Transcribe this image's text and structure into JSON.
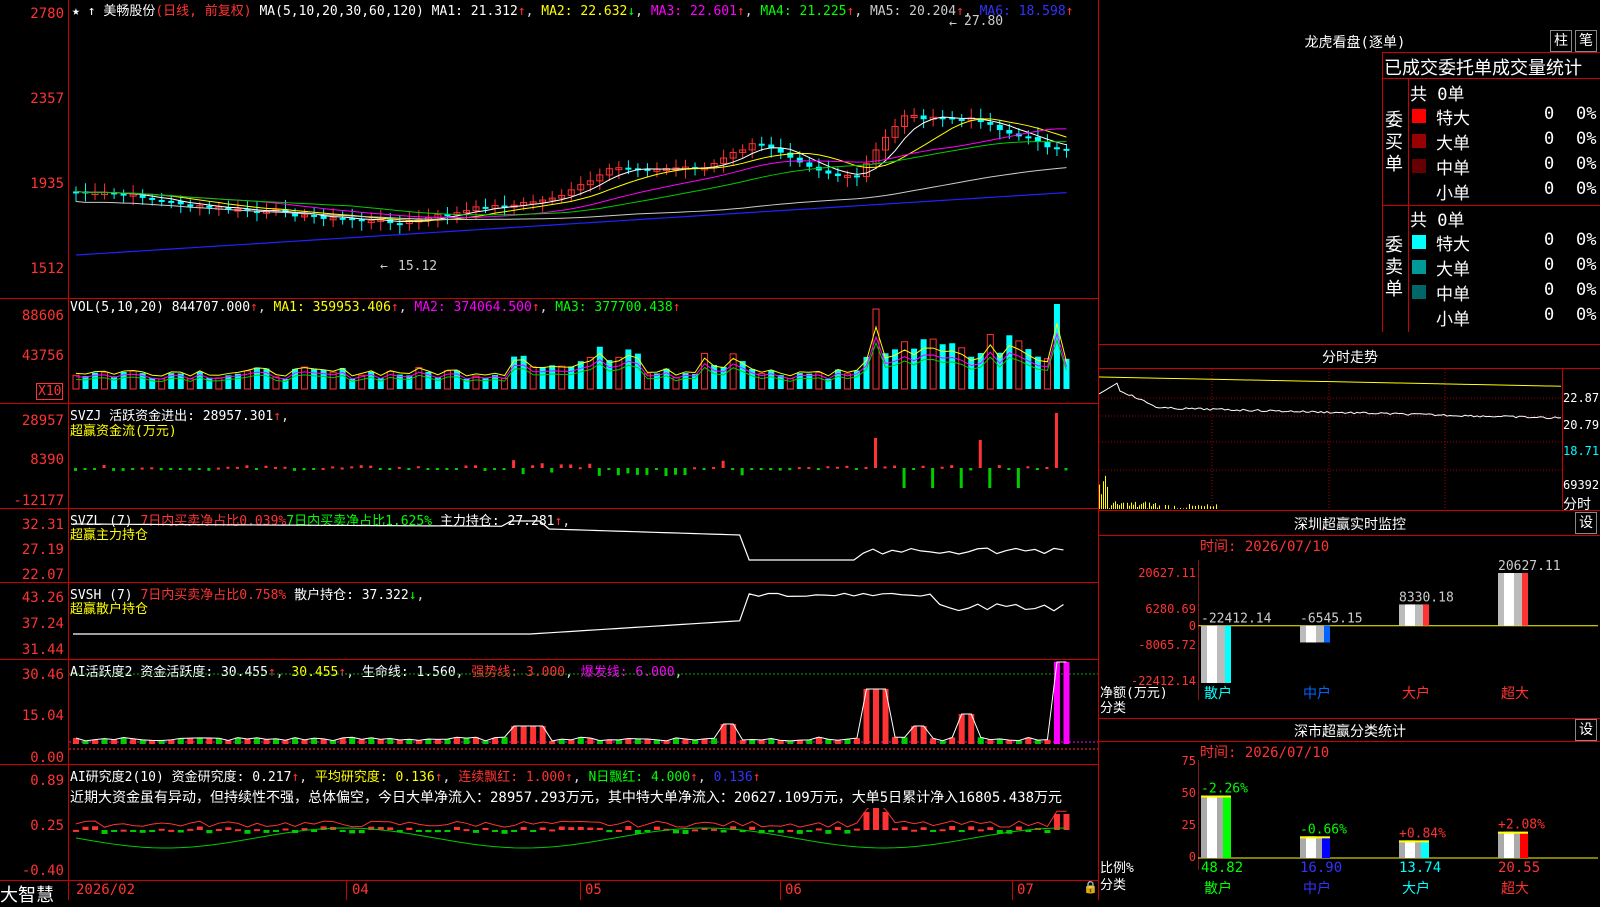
{
  "app": {
    "brand": "大智慧",
    "stock_name": "美畅股份",
    "mode": "(日线, 前复权)"
  },
  "price_panel": {
    "ticks": [
      "2780",
      "2357",
      "1935",
      "1512"
    ],
    "ma_label": "MA(5,10,20,30,60,120)",
    "ma": [
      {
        "label": "MA1: 21.312",
        "arrow": "↑",
        "color": "#ffffff"
      },
      {
        "label": "MA2: 22.632",
        "arrow": "↓",
        "color": "#ffff00"
      },
      {
        "label": "MA3: 22.601",
        "arrow": "↑",
        "color": "#ff00ff"
      },
      {
        "label": "MA4: 21.225",
        "arrow": "↑",
        "color": "#00ff00"
      },
      {
        "label": "MA5: 20.204",
        "arrow": "↑",
        "color": "#cccccc"
      },
      {
        "label": "MA6: 18.598",
        "arrow": "↑",
        "color": "#3333ff"
      }
    ],
    "high_label": "27.80",
    "low_label": "15.12"
  },
  "vol_panel": {
    "title": "VOL(5,10,20)",
    "value": "844707.000",
    "ma1": "MA1: 359953.406",
    "ma2": "MA2: 374064.500",
    "ma3": "MA3: 377700.438",
    "ticks": [
      "88606",
      "43756"
    ],
    "unit": "X10"
  },
  "svzj_panel": {
    "title": "SVZJ",
    "line1": "活跃资金进出: 28957.301",
    "sub": "超赢资金流(万元)",
    "ticks": [
      "28957",
      "8390",
      "-12177"
    ]
  },
  "svzl_panel": {
    "title": "SVZL (7)",
    "red_text": "7日内买卖净占比0.039%",
    "green_text": "7日内买卖净占比1.625%",
    "main": "主力持仓: 27.281",
    "sub": "超赢主力持仓",
    "ticks": [
      "32.31",
      "27.19",
      "22.07"
    ]
  },
  "svsh_panel": {
    "title": "SVSH (7)",
    "red_text": "7日内买卖净占比0.758%",
    "main": "散户持仓: 37.322",
    "sub": "超赢散户持仓",
    "ticks": [
      "43.26",
      "37.24",
      "31.44"
    ]
  },
  "ai_active": {
    "title": "AI活跃度2",
    "t1": "资金活跃度: 30.455",
    "t2": "30.455",
    "t3": "生命线: 1.560",
    "t4": "强势线: 3.000",
    "t5": "爆发线: 6.000",
    "ticks": [
      "30.46",
      "15.04",
      "0.00"
    ]
  },
  "ai_research": {
    "title": "AI研究度2(10)",
    "t1": "资金研究度: 0.217",
    "t2": "平均研究度: 0.136",
    "t3": "连续飘红: 1.000",
    "t4": "N日飘红: 4.000",
    "t5": "0.136",
    "comment": "近期大资金虽有异动，但持续性不强，总体偏空，今日大单净流入：28957.293万元，其中特大单净流入：20627.109万元，大单5日累计净入16805.438万元",
    "ticks": [
      "0.89",
      "0.25",
      "-0.40"
    ]
  },
  "x_axis": {
    "labels": [
      "2026/02",
      "04",
      "05",
      "06",
      "07"
    ]
  },
  "dragon_tiger": {
    "title": "龙虎看盘(逐单)",
    "btn1": "柱",
    "btn2": "笔",
    "header": "已成交委托单成交量统计",
    "buy_label": "委买单",
    "sell_label": "委卖单",
    "buy_total": "共 0单",
    "sell_total": "共 0单",
    "buy_rows": [
      {
        "name": "特大",
        "count": "0",
        "pct": "0%",
        "color": "#ff0000"
      },
      {
        "name": "大单",
        "count": "0",
        "pct": "0%",
        "color": "#990000"
      },
      {
        "name": "中单",
        "count": "0",
        "pct": "0%",
        "color": "#660000"
      },
      {
        "name": "小单",
        "count": "0",
        "pct": "0%",
        "color": "#000000"
      }
    ],
    "sell_rows": [
      {
        "name": "特大",
        "count": "0",
        "pct": "0%",
        "color": "#00ffff"
      },
      {
        "name": "大单",
        "count": "0",
        "pct": "0%",
        "color": "#009999"
      },
      {
        "name": "中单",
        "count": "0",
        "pct": "0%",
        "color": "#006666"
      },
      {
        "name": "小单",
        "count": "0",
        "pct": "0%",
        "color": "#000000"
      }
    ]
  },
  "intraday": {
    "title": "分时走势",
    "ticks": [
      "22.87",
      "20.79",
      "18.71"
    ],
    "vol_label": "69392",
    "x_label": "分时"
  },
  "sz_monitor": {
    "title": "深圳超赢实时监控",
    "btn": "设",
    "time": "时间: 2026/07/10",
    "ticks": [
      "20627.11",
      "6280.69",
      "0",
      "-8065.72",
      "-22412.14"
    ],
    "ylabel": "净额(万元)",
    "xlabel": "分类"
  },
  "sz_class": {
    "title": "深市超赢分类统计",
    "btn": "设",
    "time": "时间: 2026/07/10",
    "ticks": [
      "75",
      "50",
      "25",
      "0"
    ],
    "ylabel": "比例%",
    "xlabel": "分类"
  },
  "chart_data": [
    {
      "type": "bar",
      "title": "深圳超赢实时监控",
      "ylabel": "净额(万元)",
      "categories": [
        "散户",
        "中户",
        "大户",
        "超大"
      ],
      "values": [
        -22412.14,
        -6545.15,
        8330.18,
        20627.11
      ],
      "labels": [
        "-22412.14",
        "-6545.15",
        "8330.18",
        "20627.11"
      ],
      "ylim": [
        -22412.14,
        20627.11
      ],
      "colors": [
        "#00ffff",
        "#0066ff",
        "#ff3333",
        "#ff3333"
      ]
    },
    {
      "type": "bar",
      "title": "深市超赢分类统计",
      "ylabel": "比例%",
      "categories": [
        "散户",
        "中户",
        "大户",
        "超大"
      ],
      "values": [
        48.82,
        16.9,
        13.74,
        20.55
      ],
      "value_labels": [
        "48.82",
        "16.90",
        "13.74",
        "20.55"
      ],
      "changes": [
        "-2.26%",
        "-0.66%",
        "+0.84%",
        "+2.08%"
      ],
      "change_colors": [
        "#00ff00",
        "#00ff00",
        "#ff3333",
        "#ff3333"
      ],
      "ylim": [
        0,
        75
      ],
      "colors": [
        "#00ff00",
        "#0000ff",
        "#00ffff",
        "#ff0000"
      ]
    }
  ]
}
